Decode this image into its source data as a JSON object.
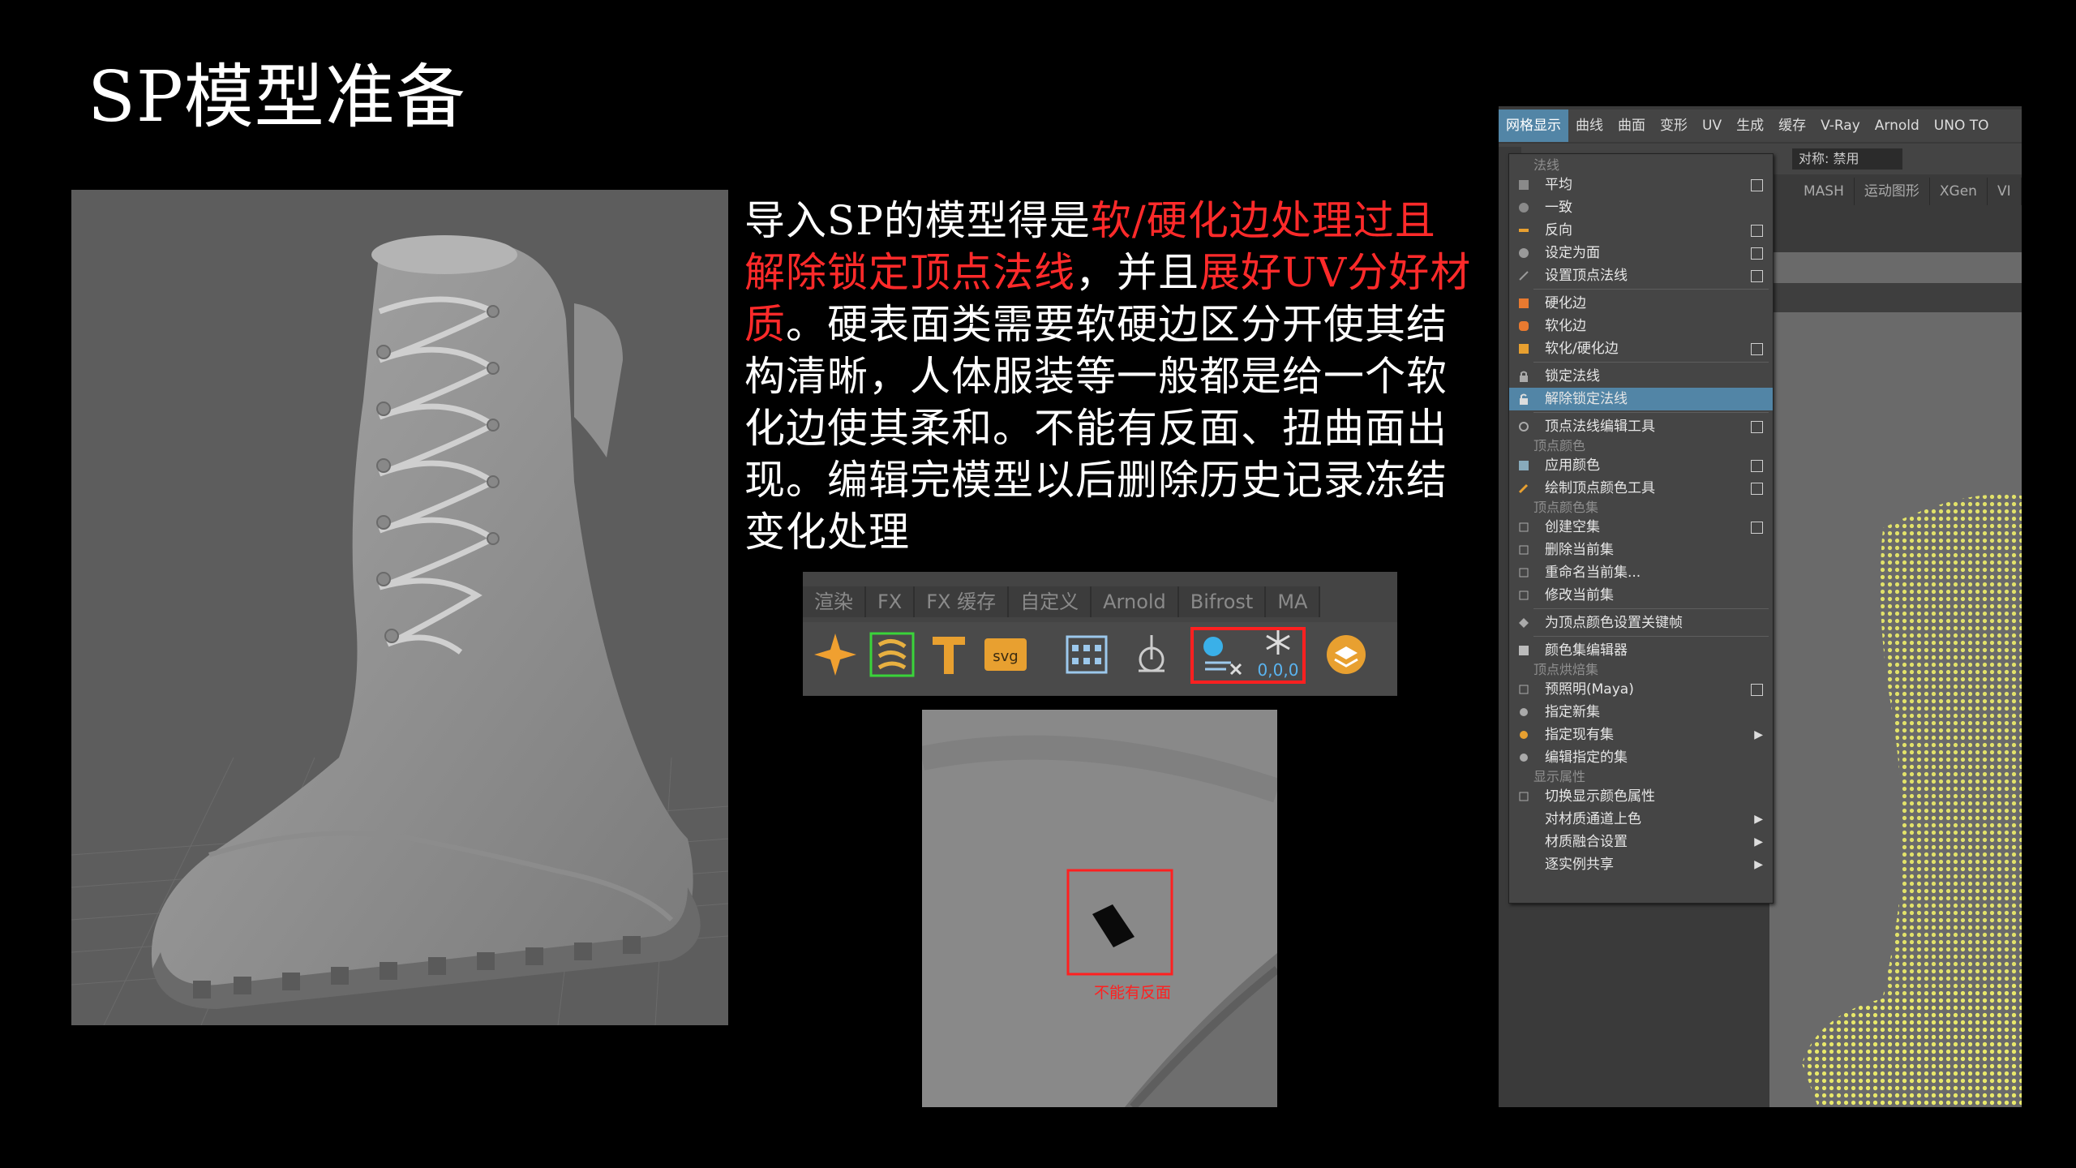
{
  "slide": {
    "title": "SP模型准备",
    "paragraph": {
      "p1": "导入SP的模型得是",
      "r1": "软/硬化边处理过且解除锁定顶点法线",
      "p2": "，并且",
      "r2": "展好UV分好材质",
      "p3": "。硬表面类需要软硬边区分开使其结构清晰，人体服装等一般都是给一个软化边使其柔和。不能有反面、扭曲面出现。编辑完模型以后删除历史记录冻结变化处理"
    },
    "closeup_label": "不能有反面"
  },
  "shelf": {
    "tabs": [
      "渲染",
      "FX",
      "FX 缓存",
      "自定义",
      "Arnold",
      "Bifrost",
      "MA"
    ],
    "icons": [
      "star-icon",
      "transform-icon",
      "text-tool-icon",
      "svg-tool-icon",
      "grid-editor-icon",
      "pivot-icon",
      "delete-history-icon",
      "freeze-transform-icon",
      "layer-icon"
    ],
    "freeze_readout": "0,0,0"
  },
  "maya": {
    "menubar": [
      "网格显示",
      "曲线",
      "曲面",
      "变形",
      "UV",
      "生成",
      "缓存",
      "V-Ray",
      "Arnold",
      "UNO TO"
    ],
    "symmetry_label": "对称: 禁用",
    "tabs": [
      "MASH",
      "运动图形",
      "XGen",
      "VI"
    ],
    "menu": {
      "sections": [
        {
          "title": "法线",
          "items": [
            {
              "label": "平均",
              "option": true
            },
            {
              "label": "一致",
              "option": false
            },
            {
              "label": "反向",
              "option": true
            },
            {
              "label": "设定为面",
              "option": true
            },
            {
              "label": "设置顶点法线",
              "option": true
            },
            {
              "label": "硬化边",
              "option": false
            },
            {
              "label": "软化边",
              "option": false
            },
            {
              "label": "软化/硬化边",
              "option": true
            },
            {
              "label": "锁定法线",
              "option": false
            },
            {
              "label": "解除锁定法线",
              "option": false,
              "highlighted": true
            },
            {
              "label": "顶点法线编辑工具",
              "option": true
            }
          ]
        },
        {
          "title": "顶点颜色",
          "items": [
            {
              "label": "应用颜色",
              "option": true
            },
            {
              "label": "绘制顶点颜色工具",
              "option": true
            }
          ]
        },
        {
          "title": "顶点颜色集",
          "items": [
            {
              "label": "创建空集",
              "option": true
            },
            {
              "label": "删除当前集",
              "option": false
            },
            {
              "label": "重命名当前集...",
              "option": false
            },
            {
              "label": "修改当前集",
              "option": false
            },
            {
              "label": "为顶点颜色设置关键帧",
              "option": false
            },
            {
              "label": "颜色集编辑器",
              "option": false
            }
          ]
        },
        {
          "title": "顶点烘焙集",
          "items": [
            {
              "label": "预照明(Maya)",
              "option": true
            },
            {
              "label": "指定新集",
              "option": false
            },
            {
              "label": "指定现有集",
              "submenu": true
            },
            {
              "label": "编辑指定的集",
              "option": false
            }
          ]
        },
        {
          "title": "显示属性",
          "items": [
            {
              "label": "切换显示颜色属性",
              "option": false
            },
            {
              "label": "对材质通道上色",
              "submenu": true
            },
            {
              "label": "材质融合设置",
              "submenu": true
            },
            {
              "label": "逐实例共享",
              "submenu": true
            }
          ]
        }
      ]
    }
  },
  "colors": {
    "accent_red": "#ff2a2a",
    "menu_highlight": "#5285a6",
    "mesh_yellow": "#e8e86a"
  }
}
